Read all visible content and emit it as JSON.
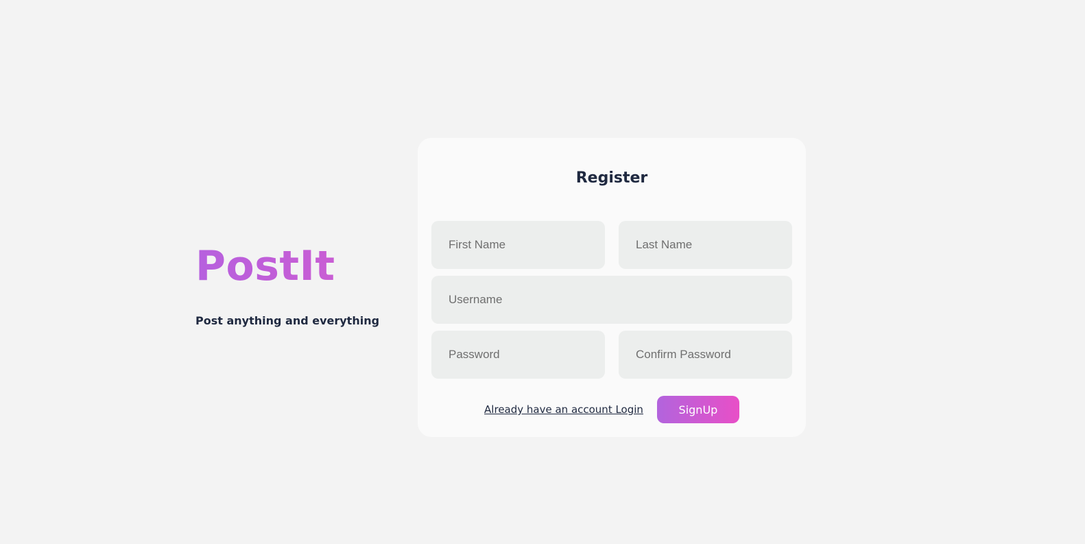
{
  "brand": {
    "logo_text": "PostIt",
    "tagline": "Post anything and everything"
  },
  "form": {
    "title": "Register",
    "fields": {
      "first_name": {
        "placeholder": "First Name",
        "value": ""
      },
      "last_name": {
        "placeholder": "Last Name",
        "value": ""
      },
      "username": {
        "placeholder": "Username",
        "value": ""
      },
      "password": {
        "placeholder": "Password",
        "value": ""
      },
      "confirm_password": {
        "placeholder": "Confirm Password",
        "value": ""
      }
    },
    "login_link_label": "Already have an account Login",
    "signup_label": "SignUp"
  },
  "colors": {
    "background": "#f3f3f3",
    "card": "#fafafa",
    "field": "#eceeed",
    "text_dark": "#1f2940",
    "accent_start": "#b264dd",
    "accent_end": "#e84fc7"
  }
}
